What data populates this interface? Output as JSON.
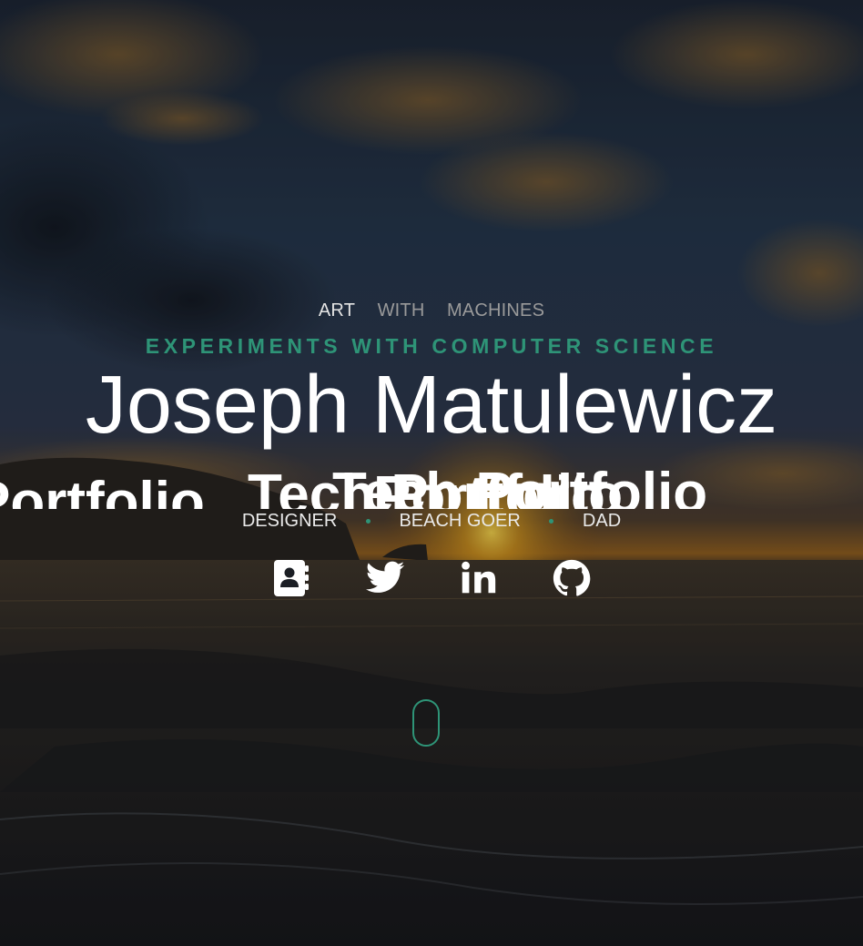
{
  "nav": {
    "items": [
      "ART",
      "WITH",
      "MACHINES"
    ]
  },
  "hero": {
    "kicker": "EXPERIMENTS WITH COMPUTER SCIENCE",
    "title": "Joseph Matulewicz",
    "ghost_text": [
      "Portfolio",
      "Tech Portfolio",
      "Tech Portfolio",
      "Portfolio"
    ],
    "roles": [
      "DESIGNER",
      "BEACH GOER",
      "DAD"
    ]
  },
  "social": [
    {
      "name": "contact",
      "icon": "contact-book-icon"
    },
    {
      "name": "twitter",
      "icon": "twitter-icon"
    },
    {
      "name": "linkedin",
      "icon": "linkedin-icon"
    },
    {
      "name": "github",
      "icon": "github-icon"
    }
  ],
  "colors": {
    "accent": "#2e9477",
    "text": "#ffffff",
    "muted": "#9a9a9a"
  }
}
